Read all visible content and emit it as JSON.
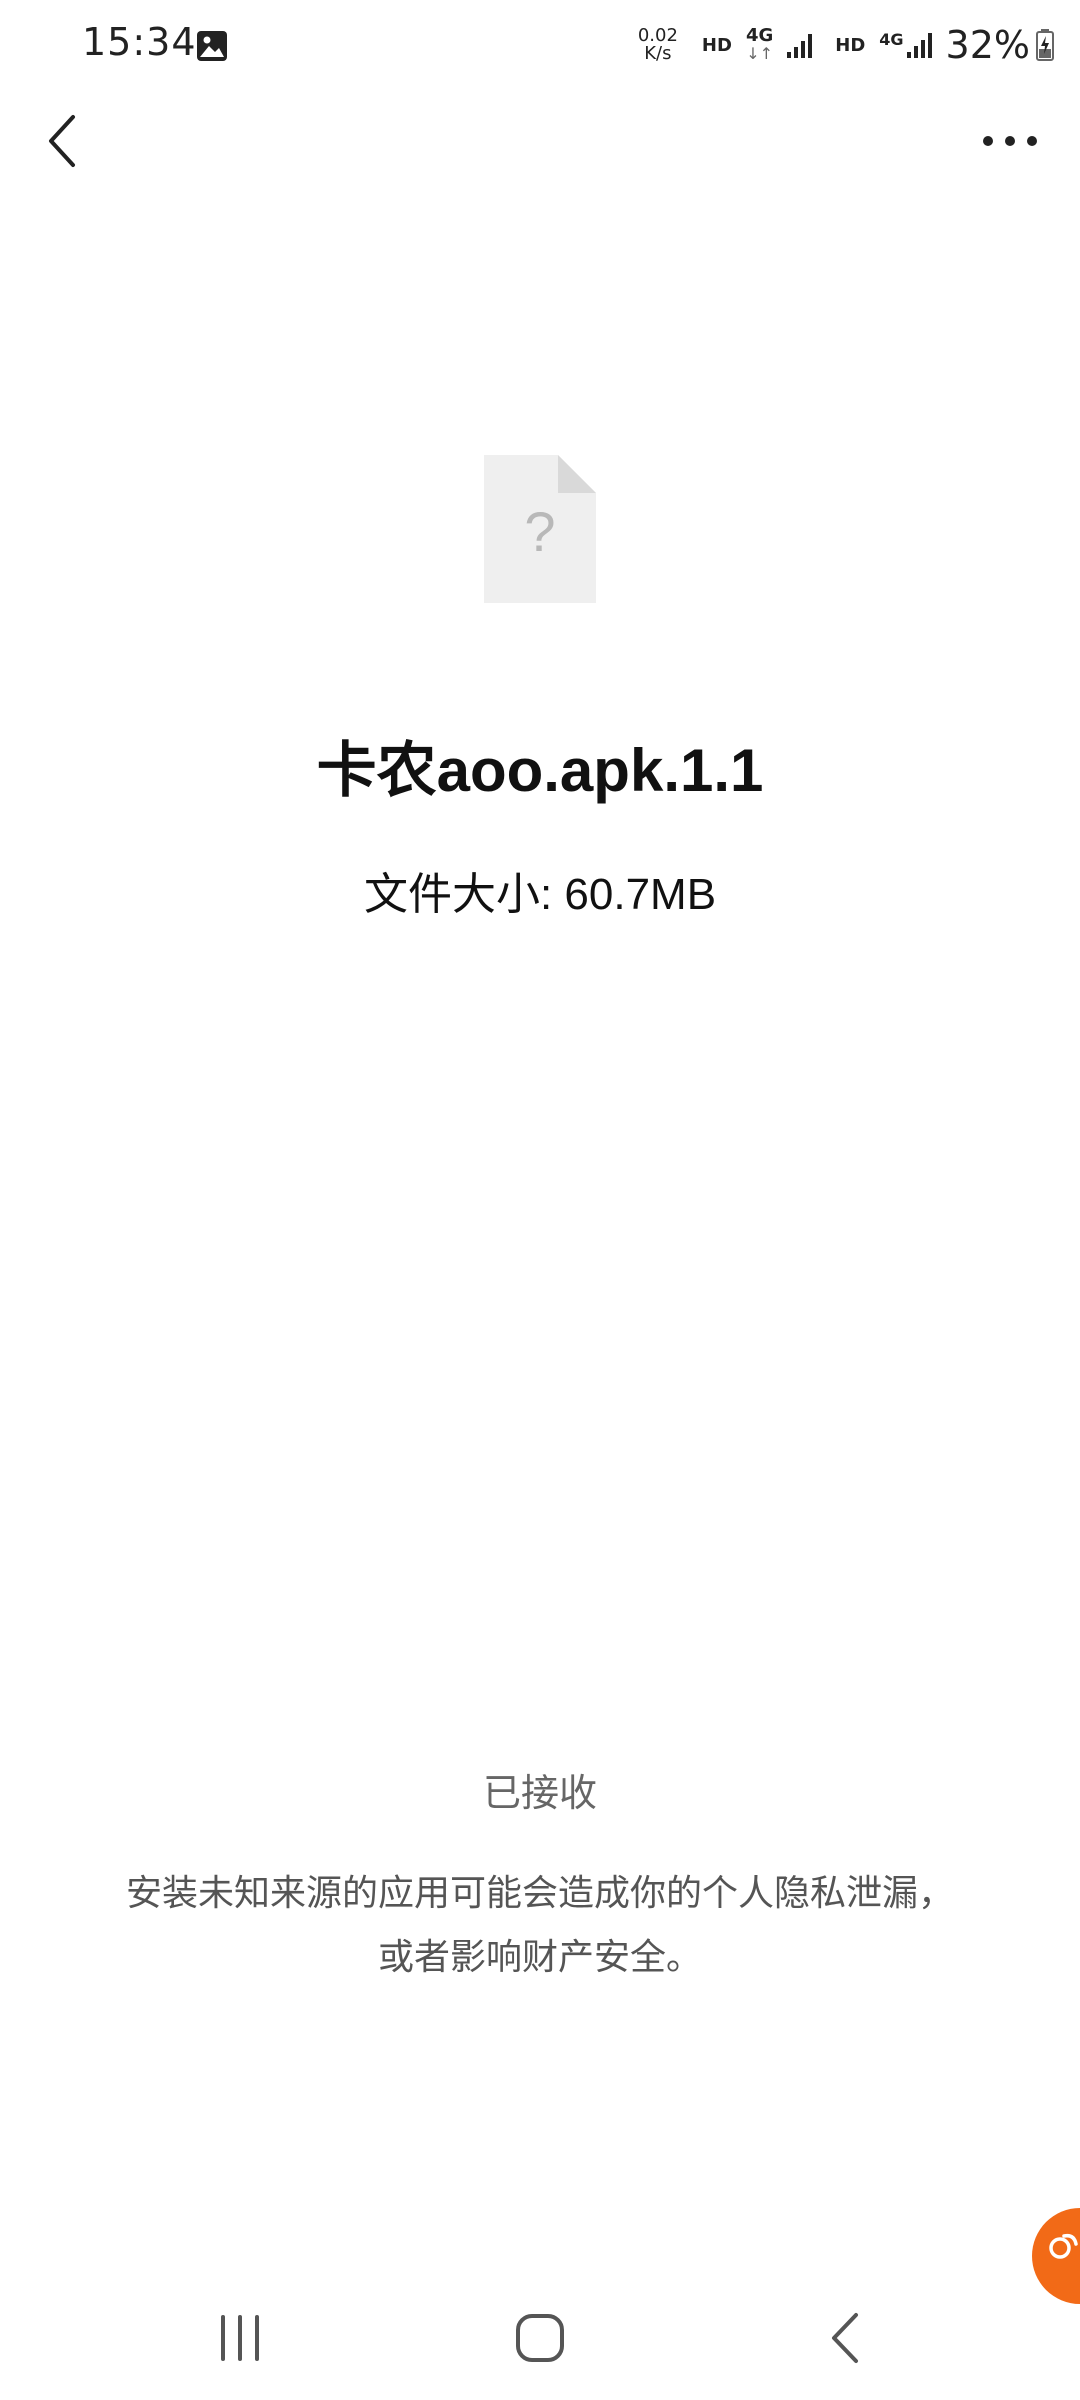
{
  "status_bar": {
    "time": "15:34",
    "gallery_icon": "image-notification-icon",
    "net_speed_value": "0.02",
    "net_speed_unit": "K/s",
    "hd_1": "HD",
    "net_type_1": "4G",
    "net_arrows": "↓↑",
    "hd_2": "HD",
    "net_type_2": "4G",
    "battery_percent": "32%",
    "battery_icon": "battery-charging-icon"
  },
  "top_bar": {
    "back_icon": "chevron-left-icon",
    "more_icon": "more-horizontal-icon"
  },
  "file": {
    "icon": "unknown-file-icon",
    "icon_glyph": "?",
    "name": "卡农aoo.apk.1.1",
    "size_label": "文件大小: 60.7MB"
  },
  "footer": {
    "status": "已接收",
    "warning_line1": "安装未知来源的应用可能会造成你的个人隐私泄漏，",
    "warning_line2": "或者影响财产安全。"
  },
  "floating_button": {
    "icon": "link-icon",
    "color": "#f26a17"
  },
  "nav_bar": {
    "recents_icon": "recents-icon",
    "home_icon": "home-icon",
    "back_icon": "back-icon"
  }
}
